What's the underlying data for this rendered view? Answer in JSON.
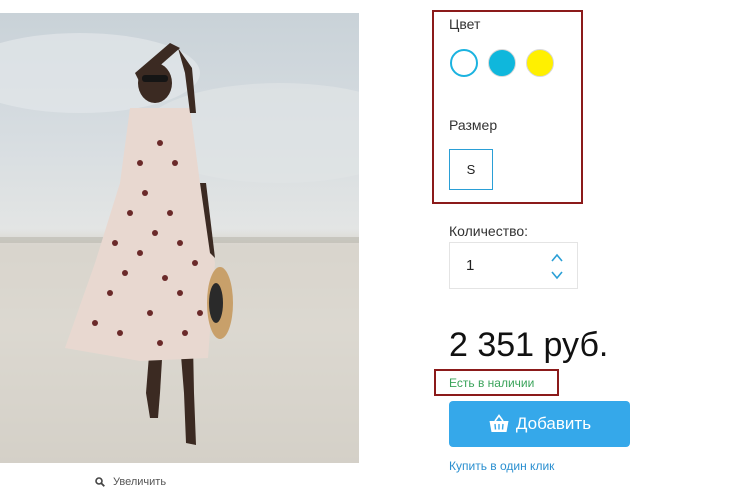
{
  "product_image": {
    "zoom_label": "Увеличить"
  },
  "options": {
    "color_label": "Цвет",
    "colors": [
      {
        "name": "white",
        "hex": "#ffffff",
        "selected": true
      },
      {
        "name": "blue",
        "hex": "#0fb7dc",
        "selected": false
      },
      {
        "name": "yellow",
        "hex": "#fff000",
        "selected": false
      }
    ],
    "size_label": "Размер",
    "sizes": [
      {
        "label": "S",
        "selected": true
      }
    ]
  },
  "quantity": {
    "label": "Количество:",
    "value": "1"
  },
  "price": {
    "text": "2 351 руб."
  },
  "availability": {
    "text": "Есть в наличии"
  },
  "actions": {
    "add_label": "Добавить",
    "one_click_label": "Купить в один клик"
  },
  "colors": {
    "accent": "#35a8ea",
    "stock_green": "#3aa35a",
    "highlight_red": "#8b1a1a",
    "link": "#2a8fd0"
  }
}
